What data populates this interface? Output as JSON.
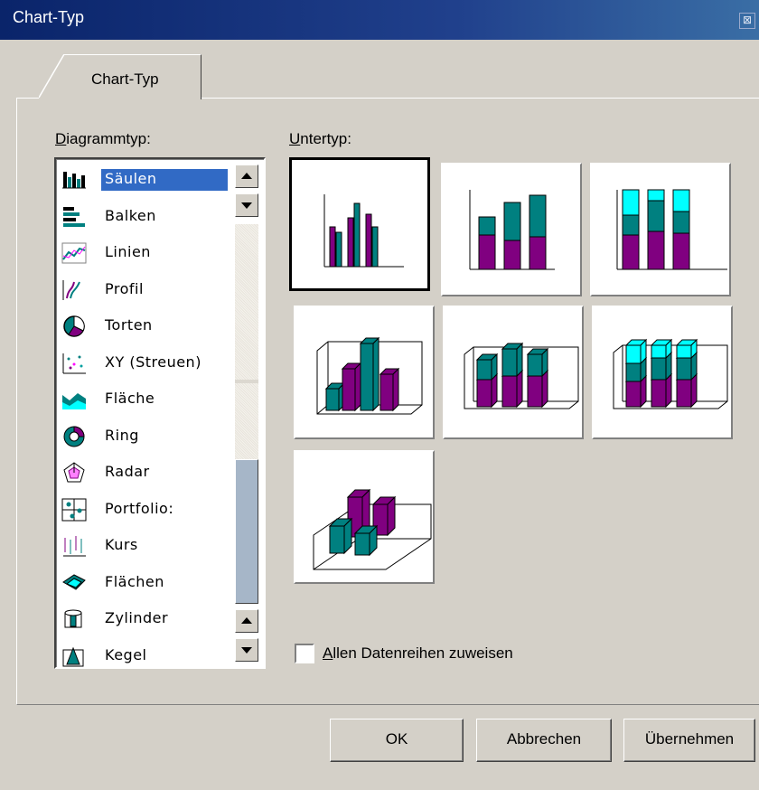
{
  "window": {
    "title": "Chart-Typ",
    "close_glyph": "⊠"
  },
  "tab": {
    "label": "Chart-Typ"
  },
  "labels": {
    "diagrammtyp_rest": "iagrammtyp:",
    "diagrammtyp_accel": "D",
    "untertyp_accel": "U",
    "untertyp_rest": "ntertyp:"
  },
  "chart_types": [
    {
      "label": "Säulen",
      "icon": "column-chart-icon",
      "selected": true
    },
    {
      "label": "Balken",
      "icon": "bar-chart-icon"
    },
    {
      "label": "Linien",
      "icon": "line-chart-icon"
    },
    {
      "label": "Profil",
      "icon": "profile-chart-icon"
    },
    {
      "label": "Torten",
      "icon": "pie-chart-icon"
    },
    {
      "label": "XY (Streuen)",
      "icon": "scatter-chart-icon"
    },
    {
      "label": "Fläche",
      "icon": "area-chart-icon"
    },
    {
      "label": "Ring",
      "icon": "ring-chart-icon"
    },
    {
      "label": "Radar",
      "icon": "radar-chart-icon"
    },
    {
      "label": "Portfolio:",
      "icon": "portfolio-chart-icon"
    },
    {
      "label": "Kurs",
      "icon": "stock-chart-icon"
    },
    {
      "label": "Flächen",
      "icon": "surface-chart-icon"
    },
    {
      "label": "Zylinder",
      "icon": "cylinder-chart-icon"
    },
    {
      "label": "Kegel",
      "icon": "cone-chart-icon"
    }
  ],
  "subtypes": [
    {
      "name": "clustered-column",
      "selected": true
    },
    {
      "name": "stacked-column"
    },
    {
      "name": "percent-stacked-column"
    },
    {
      "name": "3d-clustered-column"
    },
    {
      "name": "3d-stacked-column"
    },
    {
      "name": "3d-percent-stacked-column"
    },
    {
      "name": "3d-column"
    }
  ],
  "colors": {
    "purple": "#800080",
    "teal": "#008080",
    "cyan": "#00ffff",
    "selection": "#316ac5",
    "titlebar": "#0a246a"
  },
  "checkbox": {
    "accel": "A",
    "label_rest": "llen Datenreihen zuweisen",
    "checked": false
  },
  "buttons": {
    "ok": "OK",
    "cancel": "Abbrechen",
    "apply": "Übernehmen"
  }
}
